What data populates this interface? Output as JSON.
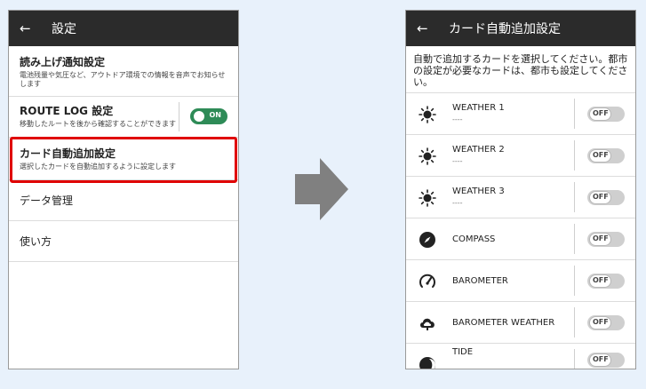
{
  "left": {
    "title": "設定",
    "items": [
      {
        "title": "読み上げ通知設定",
        "sub": "電池残量や気圧など、アウトドア環境での情報を音声でお知らせします"
      },
      {
        "title": "ROUTE LOG 設定",
        "sub": "移動したルートを後から確認することができます",
        "toggle": "ON"
      },
      {
        "title": "カード自動追加設定",
        "sub": "選択したカードを自動追加するように設定します"
      },
      {
        "title": "データ管理"
      },
      {
        "title": "使い方"
      }
    ]
  },
  "right": {
    "title": "カード自動追加設定",
    "intro": "自動で追加するカードを選択してください。都市の設定が必要なカードは、都市も設定してください。",
    "cards": [
      {
        "name": "WEATHER 1",
        "sub": "----",
        "icon": "sun-icon",
        "toggle": "OFF"
      },
      {
        "name": "WEATHER 2",
        "sub": "----",
        "icon": "sun-icon",
        "toggle": "OFF"
      },
      {
        "name": "WEATHER 3",
        "sub": "----",
        "icon": "sun-icon",
        "toggle": "OFF"
      },
      {
        "name": "COMPASS",
        "icon": "compass-icon",
        "toggle": "OFF"
      },
      {
        "name": "BAROMETER",
        "icon": "barometer-icon",
        "toggle": "OFF"
      },
      {
        "name": "BAROMETER WEATHER",
        "icon": "barometer-weather-icon",
        "toggle": "OFF"
      },
      {
        "name": "TIDE",
        "icon": "tide-icon",
        "toggle": "OFF"
      }
    ]
  },
  "colors": {
    "appbar": "#2b2b2b",
    "toggle_on": "#2e8b57",
    "highlight": "#e00000",
    "arrow": "#808080",
    "background": "#e8f1fb"
  }
}
